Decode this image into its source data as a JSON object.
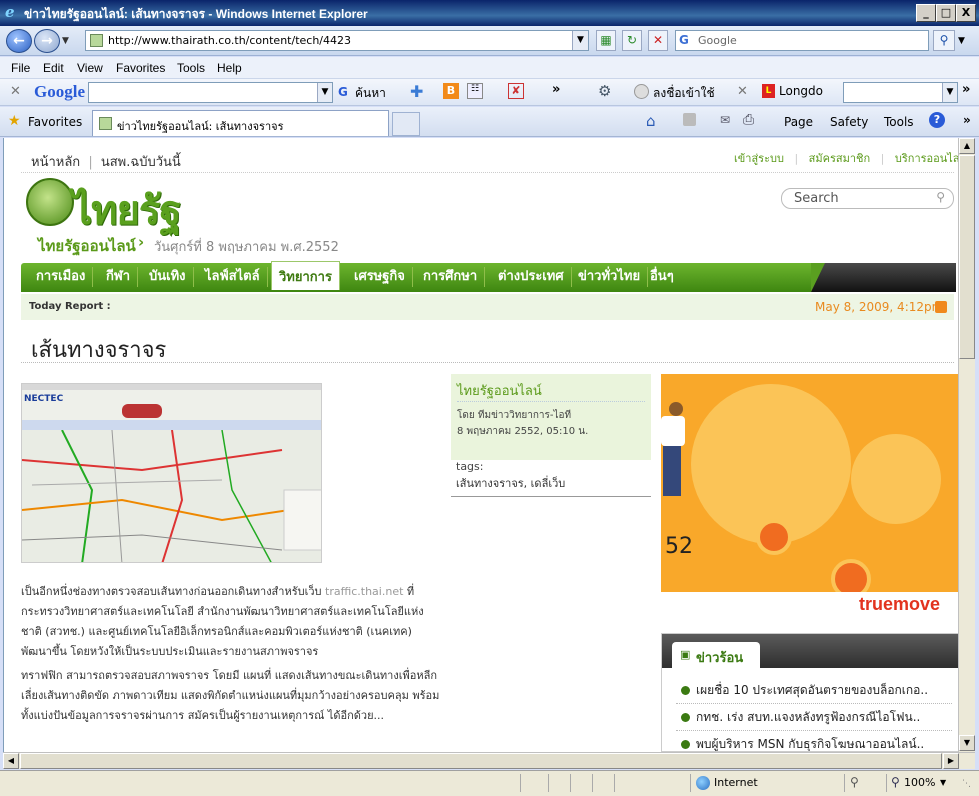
{
  "window": {
    "title": "ข่าวไทยรัฐออนไลน์: เส้นทางจราจร - Windows Internet Explorer",
    "minimize": "_",
    "maximize": "□",
    "close": "X"
  },
  "address_bar": {
    "url": "http://www.thairath.co.th/content/tech/4423",
    "search_placeholder": "Google"
  },
  "menu": [
    "File",
    "Edit",
    "View",
    "Favorites",
    "Tools",
    "Help"
  ],
  "google_toolbar": {
    "logo": "Google",
    "search_label": "ค้นหา",
    "signin_label": "ลงชื่อเข้าใช้",
    "longdo_label": "Longdo"
  },
  "favorites_bar": {
    "favorites_label": "Favorites",
    "tab_title": "ข่าวไทยรัฐออนไลน์: เส้นทางจราจร",
    "page_label": "Page",
    "safety_label": "Safety",
    "tools_label": "Tools"
  },
  "site": {
    "top_links": [
      "หน้าหลัก",
      "นสพ.ฉบับวันนี้"
    ],
    "account_links": [
      "เข้าสู่ระบบ",
      "สมัครสมาชิก",
      "บริการออนไลน์"
    ],
    "logo_text": "ไทยรัฐ",
    "brand": "ไทยรัฐออนไลน์",
    "date": "วันศุกร์ที่ 8 พฤษภาคม พ.ศ.2552",
    "search_placeholder": "Search",
    "nav": [
      "การเมือง",
      "กีฬา",
      "บันเทิง",
      "ไลฟ์สไตล์",
      "วิทยาการ",
      "เศรษฐกิจ",
      "การศึกษา",
      "ต่างประเทศ",
      "ข่าวทั่วไทย",
      "อื่นๆ"
    ],
    "nav_active_index": 4,
    "today_report": "Today Report :",
    "timestamp": "May 8, 2009, 4:12pm",
    "article_title": "เส้นทางจราจร",
    "paragraph1_before": "เป็นอีกหนึ่งช่องทางตรวจสอบเส้นทางก่อนออกเดินทางสำหรับเว็บ ",
    "paragraph1_link": "traffic.thai.net",
    "paragraph1_after": " ที่กระทรวงวิทยาศาสตร์และเทคโนโลยี สำนักงานพัฒนาวิทยาศาสตร์และเทคโนโลยีแห่งชาติ (สวทช.) และศูนย์เทคโนโลยีอิเล็กทรอนิกส์และคอมพิวเตอร์แห่งชาติ (เนคเทค) พัฒนาขึ้น โดยหวังให้เป็นระบบประเมินและรายงานสภาพจราจร",
    "paragraph2": "ทราฟฟิก สามารถตรวจสอบสภาพจราจร โดยมี แผนที่ แสดงเส้นทางขณะเดินทางเพื่อหลีกเลี่ยงเส้นทางติดขัด ภาพดาวเทียม แสดงพิกัดตำแหน่งแผนที่มุมกว้างอย่างครอบคลุม พร้อมทั้งแบ่งปันข้อมูลการจราจรผ่านการ สมัครเป็นผู้รายงานเหตุการณ์ ได้อีกด้วย...",
    "byline_source": "ไทยรัฐออนไลน์",
    "byline_author": "โดย ทีมข่าววิทยาการ-ไอที",
    "byline_date": "8 พฤษภาคม 2552, 05:10 น.",
    "tags_label": "tags:",
    "tags_value": "เส้นทางจราจร, เดลี่เว็บ",
    "ad_number": "52",
    "ad_brand": "truemove",
    "hot_news_title": "ข่าวร้อน",
    "hot_news": [
      "เผยชื่อ 10 ประเทศสุดอันตรายของบล็อกเกอ..",
      "กทช. เร่ง สบท.แจงหลังทรูฟ้องกรณีไอโฟน..",
      "พบผู้บริหาร MSN กับธุรกิจโฆษณาออนไลน์.."
    ],
    "map_logo": "NECTEC"
  },
  "status_bar": {
    "zone": "Internet",
    "zoom": "100%"
  }
}
